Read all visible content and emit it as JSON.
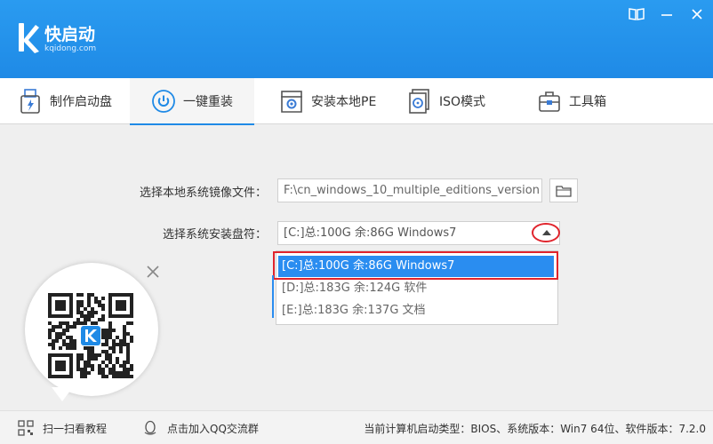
{
  "app": {
    "name": "快启动",
    "site": "kqidong.com"
  },
  "tabs": [
    {
      "label": "制作启动盘",
      "icon": "usb-drive-icon"
    },
    {
      "label": "一键重装",
      "icon": "power-icon"
    },
    {
      "label": "安装本地PE",
      "icon": "gear-box-icon"
    },
    {
      "label": "ISO模式",
      "icon": "disc-file-icon"
    },
    {
      "label": "工具箱",
      "icon": "toolbox-icon"
    }
  ],
  "active_tab": "一键重装",
  "form": {
    "image_label": "选择本地系统镜像文件：",
    "image_path": "F:\\cn_windows_10_multiple_editions_version",
    "drive_label": "选择系统安装盘符：",
    "drive_selected": "[C:]总:100G 余:86G Windows7",
    "drive_options": [
      "[C:]总:100G 余:86G Windows7",
      "[D:]总:183G 余:124G 软件",
      "[E:]总:183G 余:137G 文档"
    ]
  },
  "footer": {
    "scan_tutorial": "扫一扫看教程",
    "join_qq": "点击加入QQ交流群",
    "status": "当前计算机启动类型：BIOS、系统版本：Win7 64位、软件版本：7.2.0"
  },
  "colors": {
    "brand_blue": "#1f8ae6",
    "highlight_red": "#e0242c",
    "selection_blue": "#2a8df0"
  }
}
